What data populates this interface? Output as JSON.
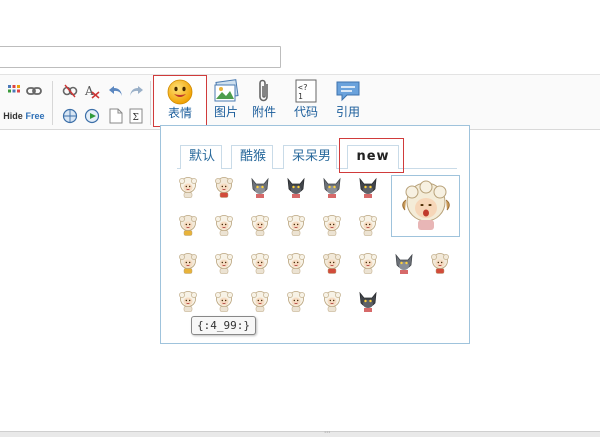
{
  "toolbar": {
    "big_buttons": [
      {
        "label": "表情",
        "icon": "smiley-face-icon"
      },
      {
        "label": "图片",
        "icon": "image-icon"
      },
      {
        "label": "附件",
        "icon": "paperclip-icon"
      },
      {
        "label": "代码",
        "icon": "code-icon"
      },
      {
        "label": "引用",
        "icon": "quote-bubble-icon"
      }
    ],
    "small_icons": [
      "grid-icon",
      "link-icon",
      "unlink-icon",
      "clear-format-icon",
      "undo-icon",
      "redo-icon",
      "hide-icon",
      "free-icon",
      "globe-icon",
      "media-play-icon",
      "page-icon",
      "sum-icon"
    ],
    "hide_label": "Hide",
    "free_label": "Free"
  },
  "emoji_panel": {
    "tabs": [
      {
        "label": "默认",
        "active": false
      },
      {
        "label": "酷猴",
        "active": false
      },
      {
        "label": "呆呆男",
        "active": false
      },
      {
        "label": "new",
        "active": true
      }
    ],
    "tooltip": "{:4_99:}",
    "rows": [
      [
        "sheep-white",
        "sheep-red",
        "wolf-gray",
        "wolf-dark",
        "wolf-gray",
        "wolf-dark"
      ],
      [
        "sheep-yellow",
        "sheep-white",
        "sheep-white",
        "sheep-white",
        "sheep-white",
        "sheep-white"
      ],
      [
        "sheep-yellow",
        "sheep-white",
        "sheep-white",
        "sheep-white",
        "sheep-red",
        "sheep-white",
        "wolf-gray",
        "sheep-red"
      ],
      [
        "sheep-white",
        "sheep-white",
        "sheep-white",
        "sheep-white",
        "sheep-white",
        "wolf-dark"
      ]
    ]
  },
  "colors": {
    "accent_label": "#1b5d9b",
    "panel_border": "#9fc3dc",
    "highlight_red": "#d03b3b"
  }
}
